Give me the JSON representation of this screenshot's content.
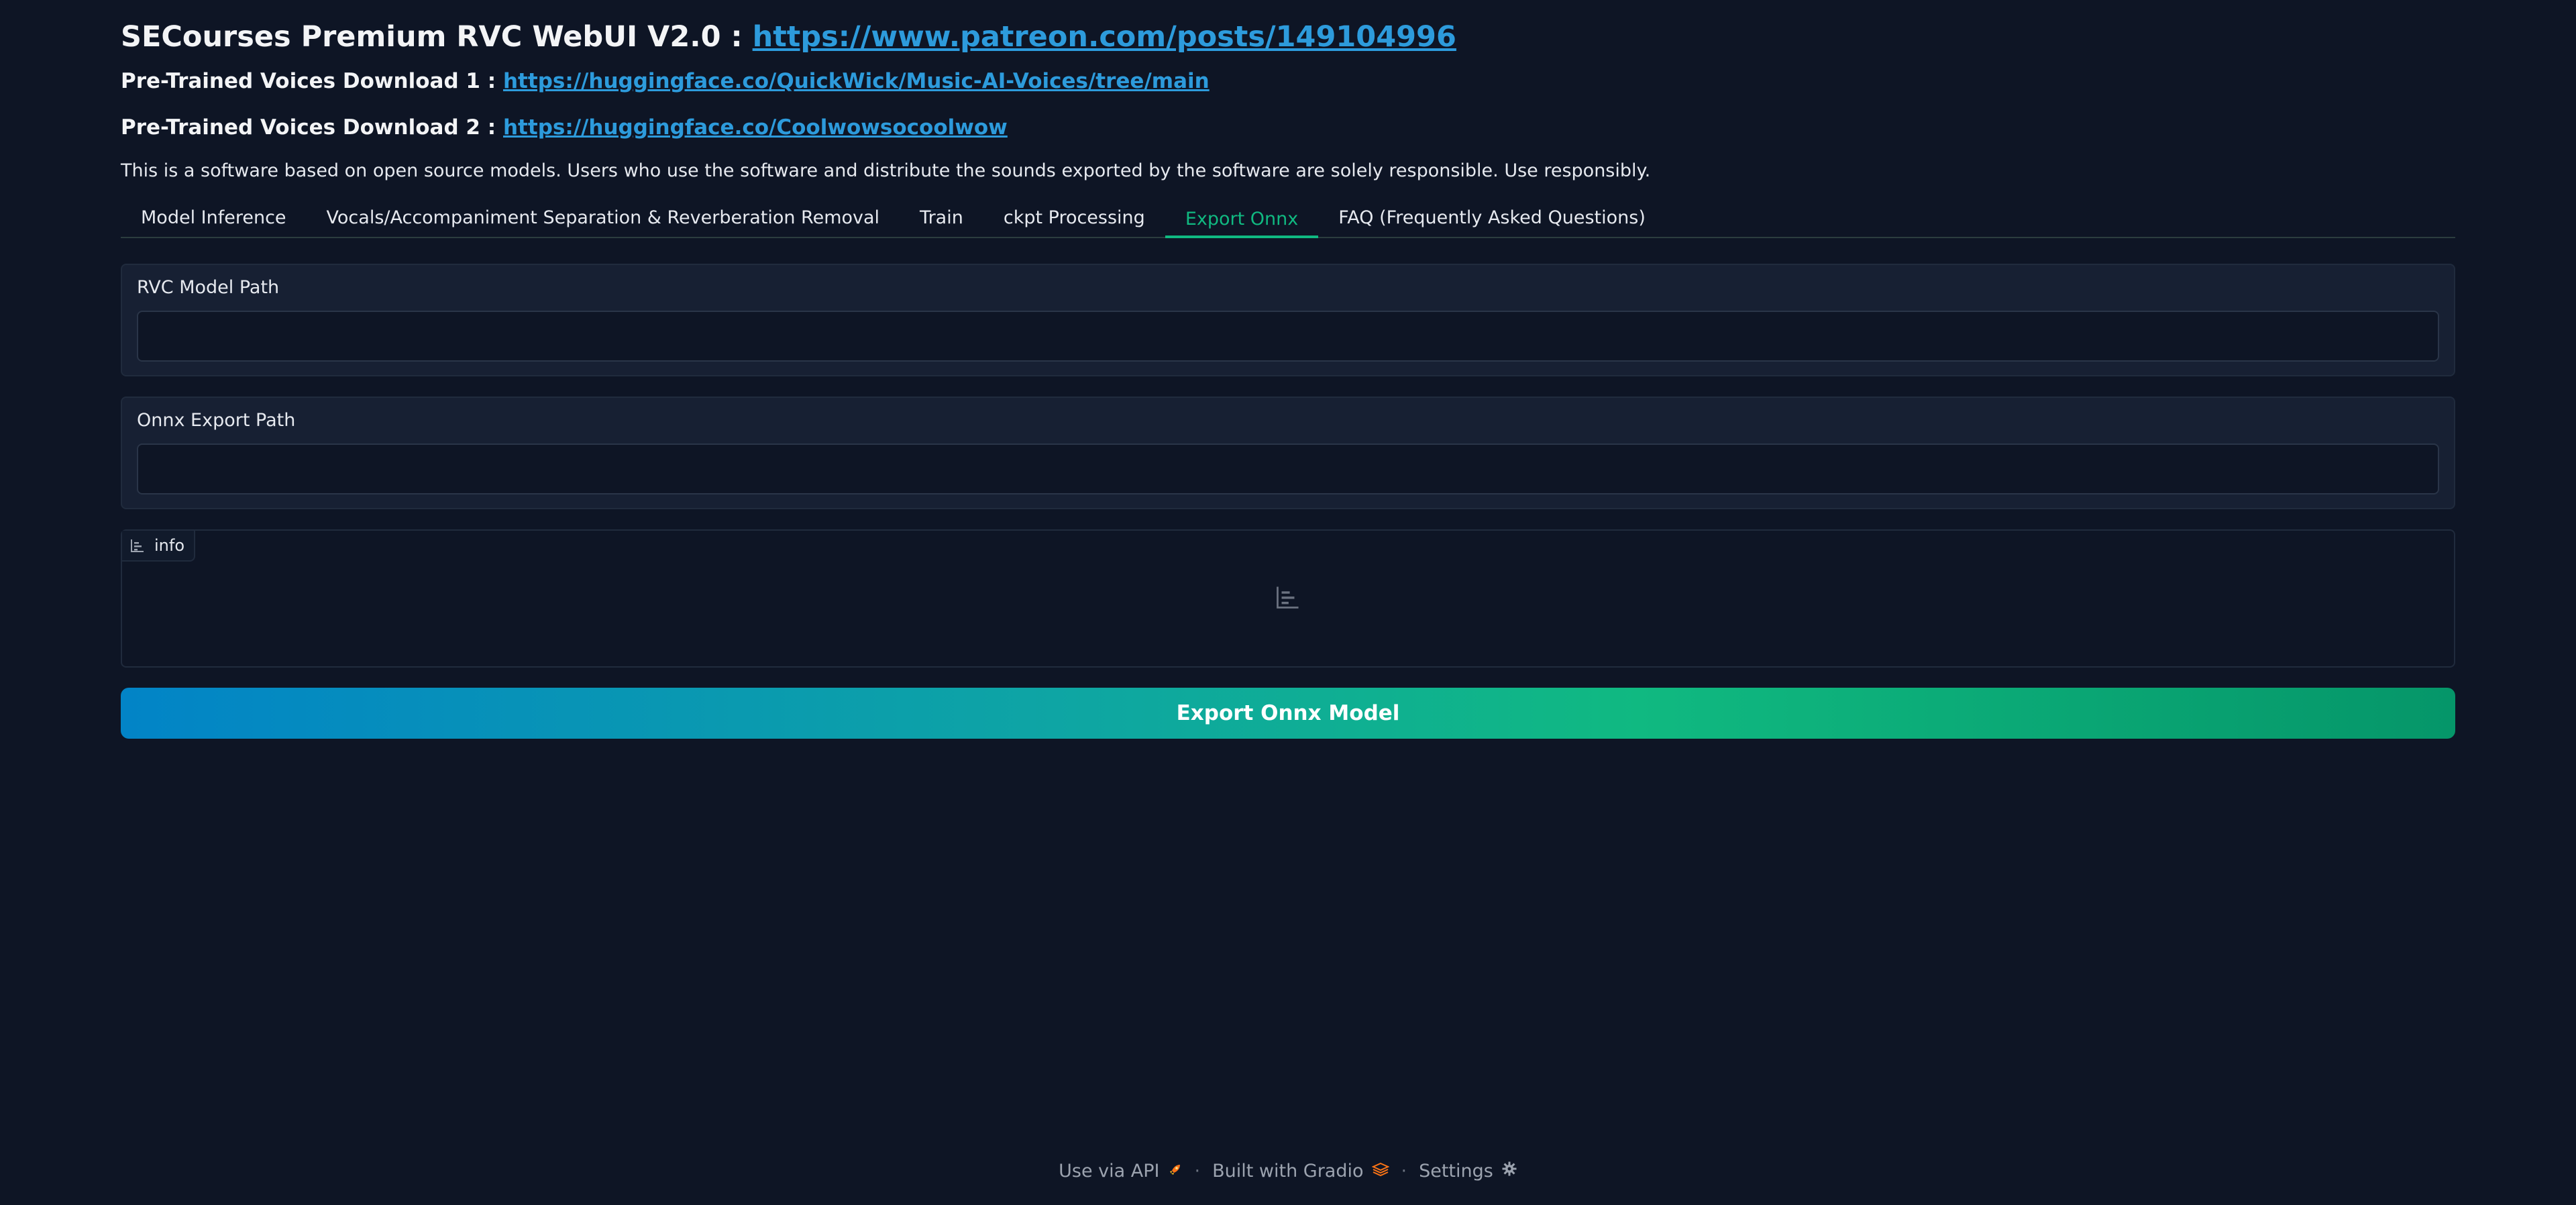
{
  "header": {
    "title_text": "SECourses Premium RVC WebUI V2.0 : ",
    "title_link": "https://www.patreon.com/posts/149104996",
    "download1_label": "Pre-Trained Voices Download 1 : ",
    "download1_link": "https://huggingface.co/QuickWick/Music-AI-Voices/tree/main",
    "download2_label": "Pre-Trained Voices Download 2 : ",
    "download2_link": "https://huggingface.co/Coolwowsocoolwow",
    "disclaimer": "This is a software based on open source models. Users who use the software and distribute the sounds exported by the software are solely responsible. Use responsibly."
  },
  "tabs": [
    {
      "label": "Model Inference",
      "selected": false
    },
    {
      "label": "Vocals/Accompaniment Separation & Reverberation Removal",
      "selected": false
    },
    {
      "label": "Train",
      "selected": false
    },
    {
      "label": "ckpt Processing",
      "selected": false
    },
    {
      "label": "Export Onnx",
      "selected": true
    },
    {
      "label": "FAQ (Frequently Asked Questions)",
      "selected": false
    }
  ],
  "form": {
    "rvc_model_path_label": "RVC Model Path",
    "rvc_model_path_value": "",
    "onnx_export_path_label": "Onnx Export Path",
    "onnx_export_path_value": "",
    "info_label": "info",
    "info_icon": "bar-chart-icon",
    "export_button_label": "Export Onnx Model"
  },
  "footer": {
    "api_label": "Use via API",
    "api_icon": "rocket-icon",
    "separator": "·",
    "gradio_label": "Built with Gradio",
    "gradio_icon": "gradio-logo-icon",
    "settings_label": "Settings",
    "settings_icon": "gear-icon"
  },
  "colors": {
    "background": "#0e1525",
    "accent": "#10b981",
    "link": "#2d9bdc",
    "button_gradient_start": "#0284c7",
    "button_gradient_end": "#059669"
  }
}
